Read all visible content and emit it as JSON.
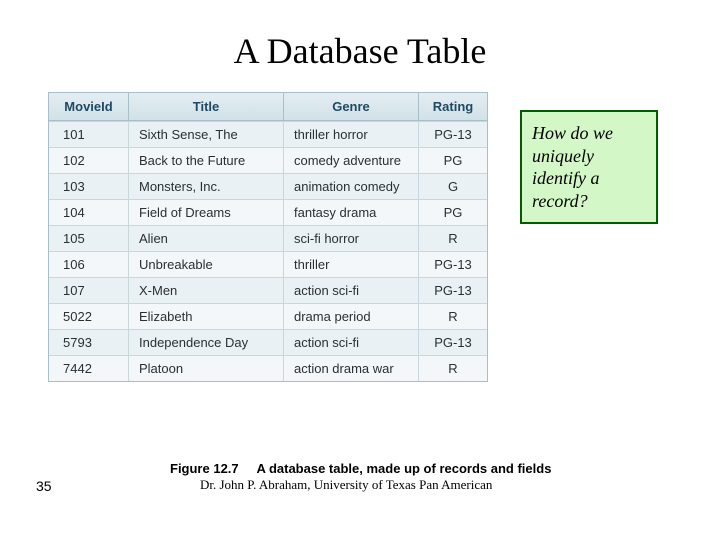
{
  "title": "A Database Table",
  "table": {
    "columns": [
      "MovieId",
      "Title",
      "Genre",
      "Rating"
    ],
    "rows": [
      {
        "id": "101",
        "title": "Sixth Sense, The",
        "genre": "thriller horror",
        "rating": "PG-13"
      },
      {
        "id": "102",
        "title": "Back to the Future",
        "genre": "comedy adventure",
        "rating": "PG"
      },
      {
        "id": "103",
        "title": "Monsters, Inc.",
        "genre": "animation comedy",
        "rating": "G"
      },
      {
        "id": "104",
        "title": "Field of Dreams",
        "genre": "fantasy drama",
        "rating": "PG"
      },
      {
        "id": "105",
        "title": "Alien",
        "genre": "sci-fi horror",
        "rating": "R"
      },
      {
        "id": "106",
        "title": "Unbreakable",
        "genre": "thriller",
        "rating": "PG-13"
      },
      {
        "id": "107",
        "title": "X-Men",
        "genre": "action sci-fi",
        "rating": "PG-13"
      },
      {
        "id": "5022",
        "title": "Elizabeth",
        "genre": "drama period",
        "rating": "R"
      },
      {
        "id": "5793",
        "title": "Independence Day",
        "genre": "action sci-fi",
        "rating": "PG-13"
      },
      {
        "id": "7442",
        "title": "Platoon",
        "genre": "action drama war",
        "rating": "R"
      }
    ]
  },
  "callout": "How do we uniquely identify a record?",
  "caption": {
    "label": "Figure 12.7",
    "text": "A database table, made up of records and fields"
  },
  "attribution": "Dr. John P. Abraham, University of Texas Pan American",
  "page_number": "35"
}
